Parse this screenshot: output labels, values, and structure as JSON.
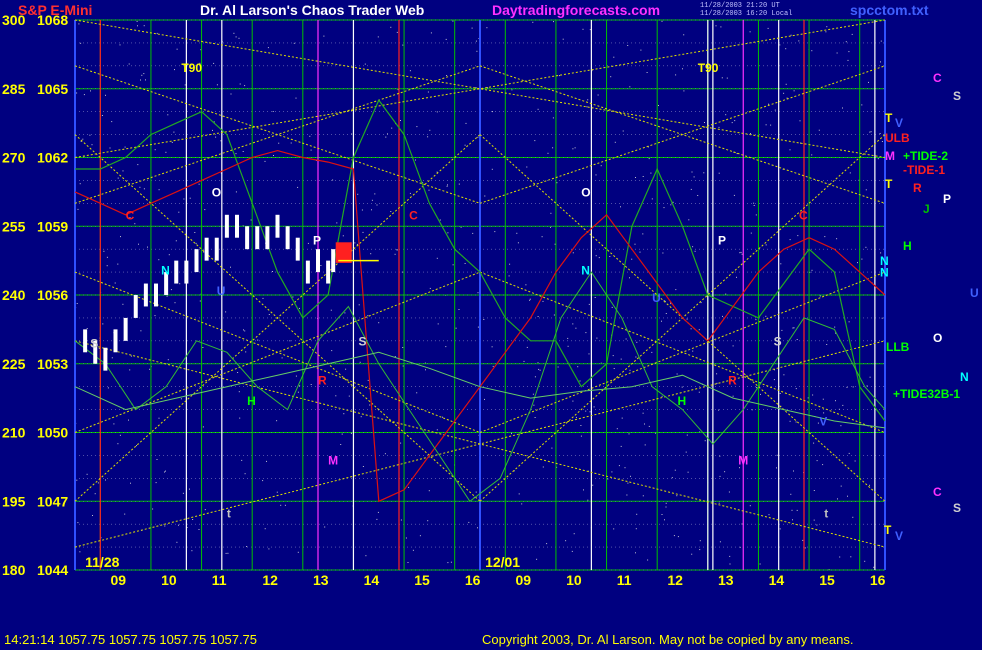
{
  "header": {
    "instrument": "S&P E-Mini",
    "title": "Dr. Al Larson's Chaos Trader Web",
    "site": "Daytradingforecasts.com",
    "stamp_line1": "11/28/2003 21:20 UT",
    "stamp_line2": "11/28/2003 16:20 Local",
    "filename": "spcctom.txt"
  },
  "footer": {
    "quote": "14:21:14  1057.75 1057.75 1057.75 1057.75",
    "copyright": "Copyright 2003, Dr. Al Larson. May not be copied by any means."
  },
  "colors": {
    "background": "#000080",
    "price_bar": "#ffffff",
    "grid_vertical": "#00c000",
    "grid_horizontal": "#00c000",
    "diagonal_lines": "#e0e000",
    "tide_green": "#22aa22",
    "tide_red": "#dd1111",
    "marker_red": "#ff2020",
    "axis_text": "#ffff00",
    "title_red": "#ff3030",
    "site_magenta": "#ff30ff",
    "filename_blue": "#4060ff"
  },
  "chart_data": {
    "type": "line",
    "y_axis": {
      "ticks_left": [
        "300",
        "285",
        "270",
        "255",
        "240",
        "225",
        "210",
        "195",
        "180"
      ],
      "ticks_price": [
        "1068",
        "1065",
        "1062",
        "1059",
        "1056",
        "1053",
        "1050",
        "1047",
        "1044"
      ],
      "price_range": [
        1044,
        1068
      ]
    },
    "x_axis": {
      "ticks": [
        "09",
        "10",
        "11",
        "12",
        "13",
        "14",
        "15",
        "16",
        "09",
        "10",
        "11",
        "12",
        "13",
        "14",
        "15",
        "16"
      ],
      "date_labels": [
        "11/28",
        "12/01"
      ]
    },
    "series": [
      {
        "kind": "price",
        "x": [
          8.2,
          8.4,
          8.6,
          8.8,
          9.0,
          9.2,
          9.4,
          9.6,
          9.8,
          10.0,
          10.2,
          10.4,
          10.6,
          10.8,
          11.0,
          11.2,
          11.4,
          11.6,
          11.8,
          12.0,
          12.2,
          12.4,
          12.6,
          12.8,
          13.0,
          13.1
        ],
        "values": [
          1054,
          1053.5,
          1053.2,
          1054,
          1054.5,
          1055.5,
          1056,
          1056,
          1056.5,
          1057,
          1057,
          1057.5,
          1058,
          1058,
          1059,
          1059,
          1058.5,
          1058.5,
          1058.5,
          1059,
          1058.5,
          1058,
          1057,
          1057.5,
          1057,
          1057.5
        ]
      },
      {
        "kind": "tide-green",
        "x": [
          8.0,
          8.5,
          9.0,
          9.5,
          10.0,
          10.5,
          11.0,
          11.5,
          12.0,
          12.5,
          13.0,
          13.5,
          14.0,
          14.5,
          15.0,
          15.5,
          16.0,
          16.5,
          17.0,
          17.5,
          18.0,
          18.5,
          19.0,
          19.5,
          20.0,
          20.5,
          21.0,
          21.5,
          22.0,
          22.5,
          23.0,
          23.5,
          24.0
        ],
        "values": [
          1061.5,
          1061.5,
          1062,
          1063,
          1063.5,
          1064,
          1063,
          1060,
          1057,
          1055,
          1056,
          1062,
          1064.5,
          1063,
          1060,
          1058,
          1057,
          1055,
          1054,
          1054,
          1052,
          1053,
          1059,
          1061.5,
          1059,
          1056,
          1055.5,
          1055,
          1056.5,
          1058,
          1057,
          1052,
          1050.5
        ]
      },
      {
        "kind": "tide-red",
        "x": [
          8.0,
          8.5,
          9.0,
          9.5,
          10.0,
          10.5,
          11.0,
          11.5,
          12.0,
          12.5,
          13.0,
          13.5,
          14.0,
          14.5,
          15.0,
          15.5,
          16.0,
          16.5,
          17.0,
          17.5,
          18.0,
          18.5,
          19.0,
          19.5,
          20.0,
          20.5,
          21.0,
          21.5,
          22.0,
          22.5,
          23.0,
          23.5,
          24.0
        ],
        "values": [
          1060.5,
          1060,
          1059.5,
          1060,
          1060.5,
          1061,
          1061.5,
          1062,
          1062.3,
          1062,
          1061.8,
          1061.5,
          1047,
          1047.5,
          1049,
          1050.5,
          1052,
          1053.5,
          1055,
          1057,
          1058.5,
          1059.5,
          1058,
          1056.5,
          1055,
          1054,
          1055.5,
          1057,
          1058,
          1058.5,
          1058,
          1057,
          1056
        ]
      },
      {
        "kind": "wave-green",
        "x": [
          8.0,
          8.6,
          9.2,
          9.8,
          10.4,
          11.0,
          11.6,
          12.2,
          12.8,
          13.4,
          14.0,
          14.6,
          15.2,
          15.8,
          16.4,
          17.0,
          17.6,
          18.2,
          18.8,
          19.4,
          20.0,
          20.6,
          21.2,
          21.8,
          22.4,
          23.0,
          23.6,
          24.0
        ],
        "values": [
          1054,
          1053,
          1051,
          1052,
          1054,
          1053.5,
          1052,
          1051,
          1054,
          1055.5,
          1053,
          1051,
          1049,
          1047,
          1048,
          1051,
          1055,
          1057,
          1055,
          1052,
          1051,
          1049.5,
          1051,
          1053,
          1055,
          1054.5,
          1052,
          1051
        ]
      },
      {
        "kind": "lower-green",
        "x": [
          8.0,
          9.0,
          10.0,
          11.0,
          12.0,
          13.0,
          14.0,
          15.0,
          16.0,
          17.0,
          18.0,
          19.0,
          20.0,
          21.0,
          22.0,
          23.0,
          24.0
        ],
        "values": [
          1052,
          1051,
          1051.5,
          1052,
          1052.5,
          1053,
          1053.5,
          1052.8,
          1052,
          1051.5,
          1051.8,
          1052,
          1052.5,
          1051.5,
          1051,
          1050.5,
          1050.2
        ]
      }
    ],
    "top_label_t90": [
      "T90",
      "T90"
    ],
    "letter_markers": [
      {
        "t": "S",
        "c": "#d0d0d0"
      },
      {
        "t": "N",
        "c": "#00ffff"
      },
      {
        "t": "O",
        "c": "#ffffff"
      },
      {
        "t": "U",
        "c": "#4060ff"
      },
      {
        "t": "P",
        "c": "#ffffff"
      },
      {
        "t": "R",
        "c": "#ff2020"
      },
      {
        "t": "M",
        "c": "#ff30ff"
      },
      {
        "t": "S",
        "c": "#d0d0d0"
      },
      {
        "t": "H",
        "c": "#00ff00"
      },
      {
        "t": "t",
        "c": "#c0c0c0"
      },
      {
        "t": "C",
        "c": "#ff2020"
      },
      {
        "t": "C",
        "c": "#ff2020"
      },
      {
        "t": "O",
        "c": "#ffffff"
      },
      {
        "t": "N",
        "c": "#00ffff"
      },
      {
        "t": "U",
        "c": "#4060ff"
      },
      {
        "t": "P",
        "c": "#ffffff"
      },
      {
        "t": "R",
        "c": "#ff2020"
      },
      {
        "t": "H",
        "c": "#00ff00"
      },
      {
        "t": "M",
        "c": "#ff30ff"
      },
      {
        "t": "S",
        "c": "#d0d0d0"
      },
      {
        "t": "V",
        "c": "#4060ff"
      },
      {
        "t": "t",
        "c": "#c0c0c0"
      },
      {
        "t": "C",
        "c": "#ff2020"
      },
      {
        "t": "N",
        "c": "#00ffff"
      }
    ],
    "right_labels": [
      {
        "t": "C",
        "c": "#ff30ff"
      },
      {
        "t": "S",
        "c": "#d0d0d0"
      },
      {
        "t": "T",
        "c": "#ffff00"
      },
      {
        "t": "V",
        "c": "#4060ff"
      },
      {
        "t": "ULB",
        "c": "#ff2020"
      },
      {
        "t": "M",
        "c": "#ff30ff"
      },
      {
        "t": "+TIDE-2",
        "c": "#00ff00"
      },
      {
        "t": "-TIDE-1",
        "c": "#ff2020"
      },
      {
        "t": "T",
        "c": "#ffff00"
      },
      {
        "t": "R",
        "c": "#ff2020"
      },
      {
        "t": "J",
        "c": "#00c000"
      },
      {
        "t": "P",
        "c": "#ffffff"
      },
      {
        "t": "H",
        "c": "#00ff00"
      },
      {
        "t": "N",
        "c": "#00ffff"
      },
      {
        "t": "U",
        "c": "#4060ff"
      },
      {
        "t": "O",
        "c": "#ffffff"
      },
      {
        "t": "LLB",
        "c": "#00ff00"
      },
      {
        "t": "N",
        "c": "#00ffff"
      },
      {
        "t": "+TIDE32B-1",
        "c": "#00ff00"
      },
      {
        "t": "C",
        "c": "#ff30ff"
      },
      {
        "t": "S",
        "c": "#d0d0d0"
      },
      {
        "t": "T",
        "c": "#ffff00"
      },
      {
        "t": "V",
        "c": "#4060ff"
      }
    ]
  }
}
